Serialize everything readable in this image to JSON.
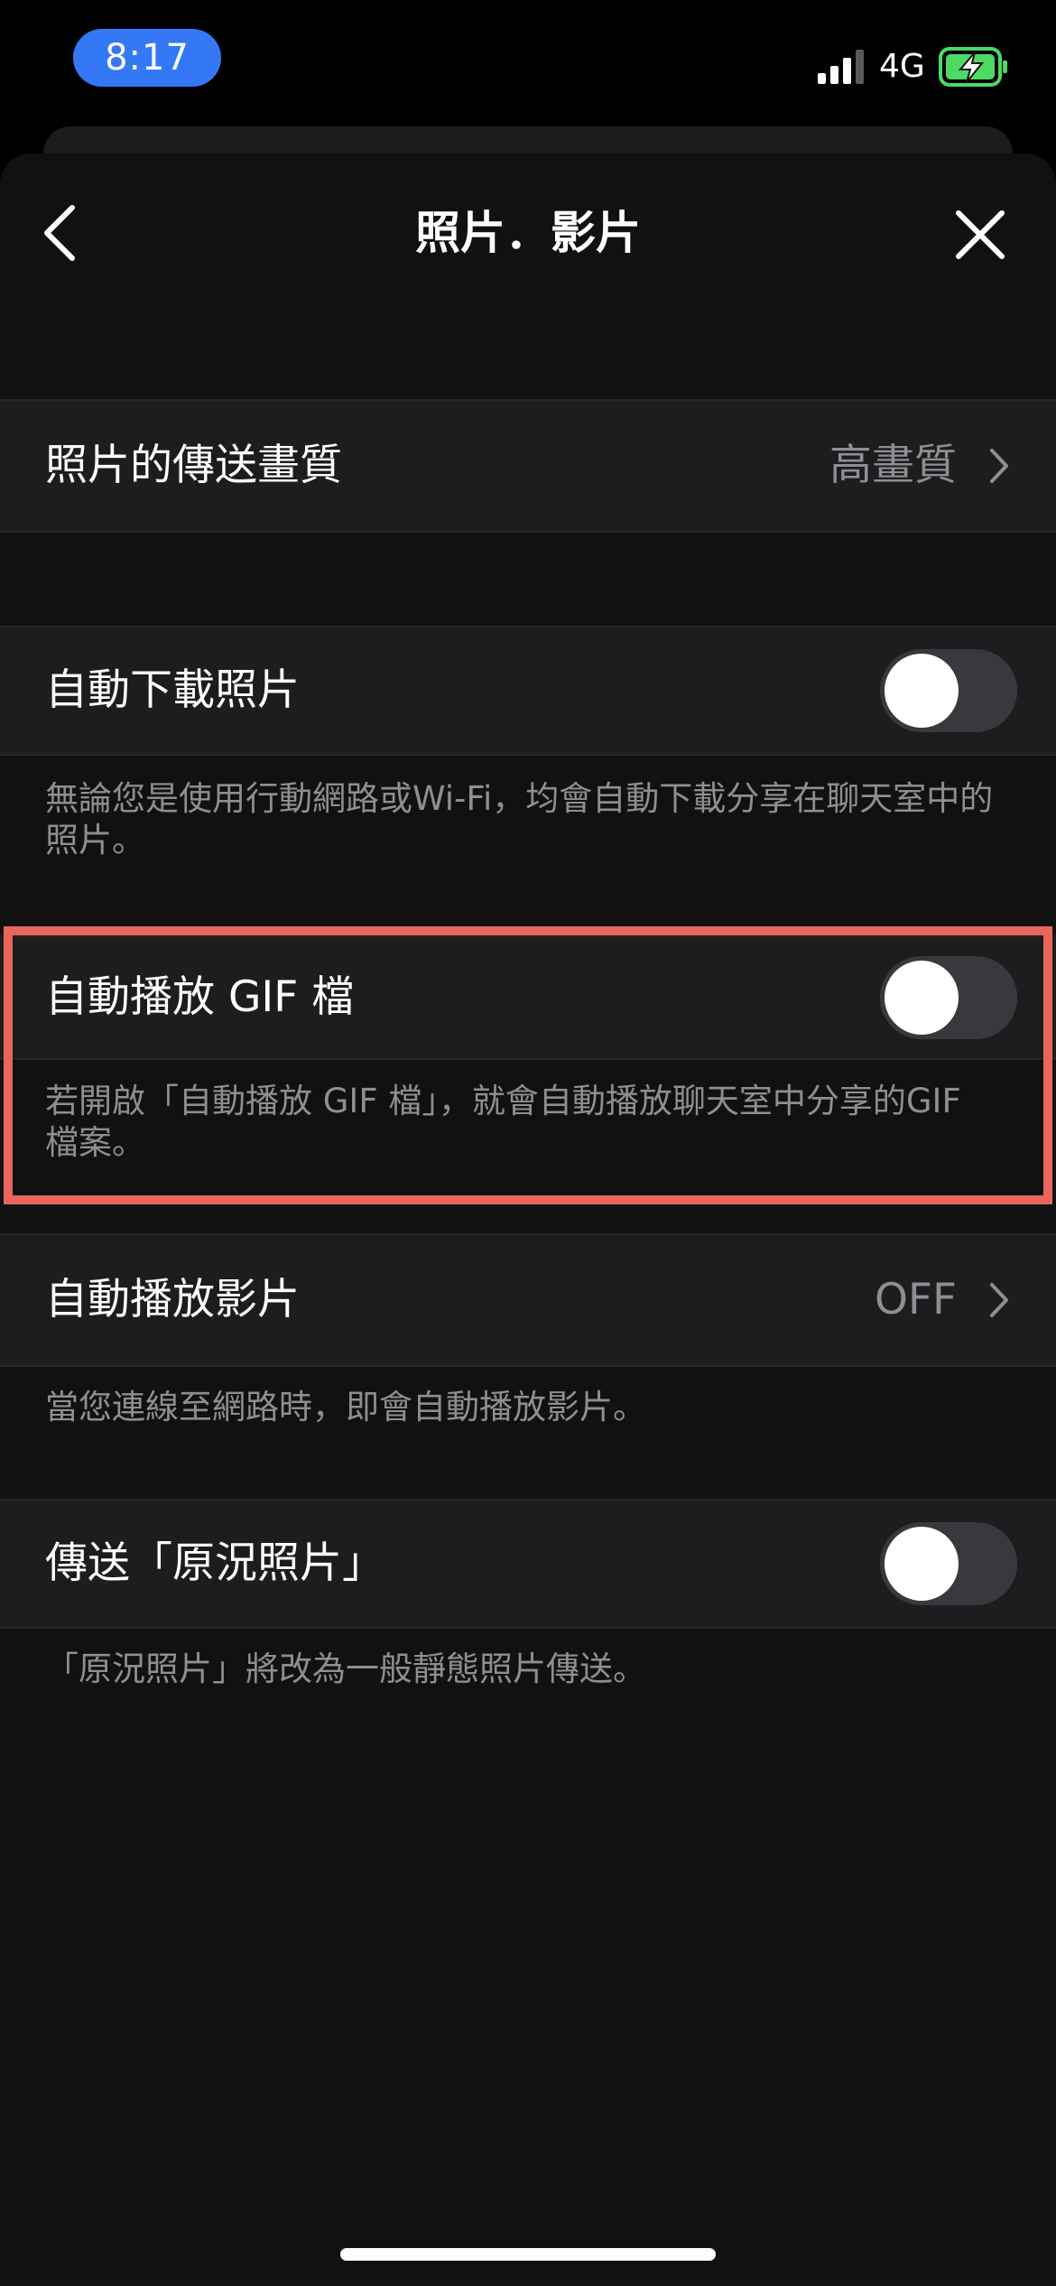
{
  "status_bar": {
    "time": "8:17",
    "network": "4G",
    "time_pill_color": "#3478f6",
    "battery_color": "#4cd964"
  },
  "nav": {
    "title": "照片．影片",
    "back_icon": "chevron-left-icon",
    "close_icon": "close-icon"
  },
  "settings": {
    "photo_quality": {
      "label": "照片的傳送畫質",
      "value": "高畫質"
    },
    "auto_download_photos": {
      "label": "自動下載照片",
      "enabled": false,
      "description": "無論您是使用行動網路或Wi-Fi，均會自動下載分享在聊天室中的照片。"
    },
    "autoplay_gif": {
      "label": "自動播放 GIF 檔",
      "enabled": false,
      "description": "若開啟「自動播放 GIF 檔」，就會自動播放聊天室中分享的GIF 檔案。",
      "highlight_color": "#e8665c"
    },
    "autoplay_videos": {
      "label": "自動播放影片",
      "value": "OFF",
      "description": "當您連線至網路時，即會自動播放影片。"
    },
    "send_live_photos": {
      "label": "傳送「原況照片」",
      "enabled": false,
      "description": "「原況照片」將改為一般靜態照片傳送。"
    }
  }
}
